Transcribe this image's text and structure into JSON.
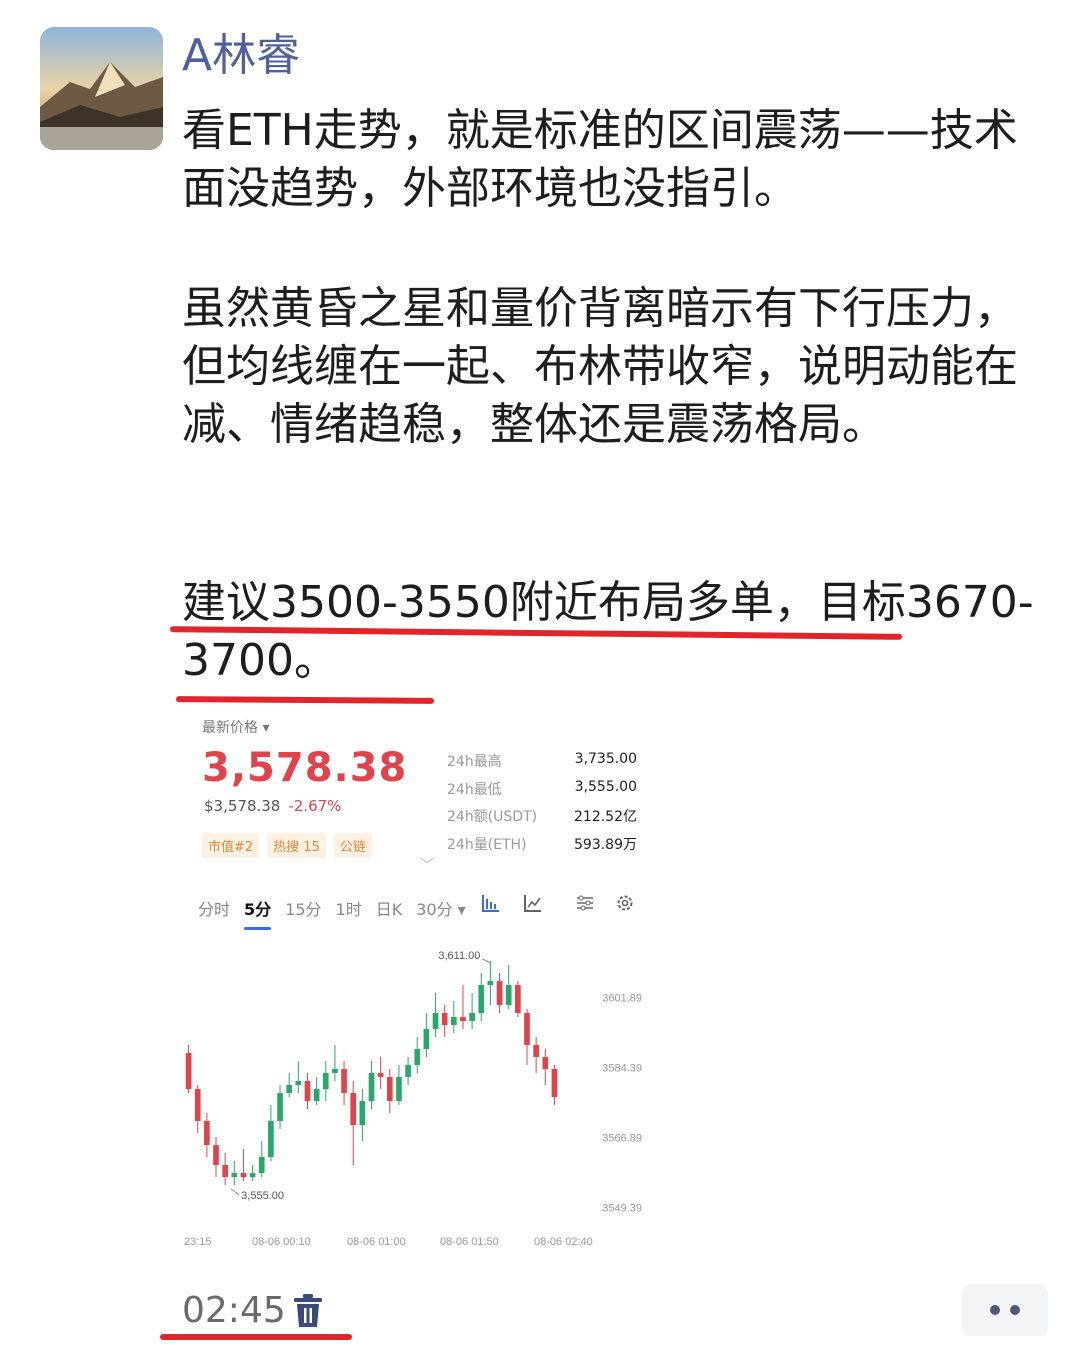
{
  "post": {
    "author": "A林睿",
    "paragraph1": "看ETH走势，就是标准的区间震荡——技术面没趋势，外部环境也没指引。",
    "paragraph2": "虽然黄昏之星和量价背离暗示有下行压力，但均线缠在一起、布林带收窄，说明动能在减、情绪趋稳，整体还是震荡格局。",
    "paragraph3": "建议3500-3550附近布局多单，目标3670-3700。",
    "time": "02:45"
  },
  "ticker": {
    "price_label": "最新价格",
    "price": "3,578.38",
    "price_usd": "$3,578.38",
    "change": "-2.67%",
    "tags": [
      "市值#2",
      "热搜 15",
      "公链"
    ],
    "stats": [
      {
        "label": "24h最高",
        "value": "3,735.00"
      },
      {
        "label": "24h最低",
        "value": "3,555.00"
      },
      {
        "label": "24h额(USDT)",
        "value": "212.52亿"
      },
      {
        "label": "24h量(ETH)",
        "value": "593.89万"
      }
    ],
    "timeframes": [
      "分时",
      "5分",
      "15分",
      "1时",
      "日K",
      "30分"
    ],
    "active_timeframe": "5分"
  },
  "chart_data": {
    "type": "candlestick",
    "title": "",
    "up_color": "#2aa86b",
    "down_color": "#e0434b",
    "y_ticks": [
      3601.89,
      3584.39,
      3566.89,
      3549.39
    ],
    "ylim": [
      3545,
      3615
    ],
    "x_ticks": [
      "23:15",
      "08-06 00:10",
      "08-06 01:00",
      "08-06 01:50",
      "08-06 02:40"
    ],
    "annotations": [
      {
        "label": "3,611.00",
        "value": 3611.0
      },
      {
        "label": "3,555.00",
        "value": 3555.0
      }
    ],
    "candles": [
      {
        "o": 3588,
        "c": 3579,
        "h": 3590,
        "l": 3578
      },
      {
        "o": 3579,
        "c": 3571,
        "h": 3580,
        "l": 3568
      },
      {
        "o": 3571,
        "c": 3565,
        "h": 3573,
        "l": 3562
      },
      {
        "o": 3565,
        "c": 3560,
        "h": 3567,
        "l": 3557
      },
      {
        "o": 3560,
        "c": 3557,
        "h": 3563,
        "l": 3555
      },
      {
        "o": 3557,
        "c": 3558,
        "h": 3561,
        "l": 3555
      },
      {
        "o": 3558,
        "c": 3557,
        "h": 3564,
        "l": 3556
      },
      {
        "o": 3557,
        "c": 3558,
        "h": 3560,
        "l": 3556
      },
      {
        "o": 3558,
        "c": 3562,
        "h": 3566,
        "l": 3557
      },
      {
        "o": 3562,
        "c": 3571,
        "h": 3575,
        "l": 3561
      },
      {
        "o": 3571,
        "c": 3578,
        "h": 3580,
        "l": 3569
      },
      {
        "o": 3578,
        "c": 3580,
        "h": 3583,
        "l": 3577
      },
      {
        "o": 3580,
        "c": 3581,
        "h": 3586,
        "l": 3578
      },
      {
        "o": 3581,
        "c": 3576,
        "h": 3583,
        "l": 3574
      },
      {
        "o": 3576,
        "c": 3579,
        "h": 3582,
        "l": 3575
      },
      {
        "o": 3579,
        "c": 3583,
        "h": 3586,
        "l": 3576
      },
      {
        "o": 3583,
        "c": 3584,
        "h": 3590,
        "l": 3581
      },
      {
        "o": 3584,
        "c": 3578,
        "h": 3586,
        "l": 3575
      },
      {
        "o": 3578,
        "c": 3570,
        "h": 3581,
        "l": 3560
      },
      {
        "o": 3570,
        "c": 3576,
        "h": 3579,
        "l": 3566
      },
      {
        "o": 3576,
        "c": 3583,
        "h": 3586,
        "l": 3574
      },
      {
        "o": 3583,
        "c": 3582,
        "h": 3587,
        "l": 3579
      },
      {
        "o": 3582,
        "c": 3576,
        "h": 3584,
        "l": 3573
      },
      {
        "o": 3576,
        "c": 3582,
        "h": 3585,
        "l": 3575
      },
      {
        "o": 3582,
        "c": 3585,
        "h": 3587,
        "l": 3580
      },
      {
        "o": 3585,
        "c": 3589,
        "h": 3592,
        "l": 3583
      },
      {
        "o": 3589,
        "c": 3594,
        "h": 3598,
        "l": 3587
      },
      {
        "o": 3594,
        "c": 3598,
        "h": 3603,
        "l": 3592
      },
      {
        "o": 3598,
        "c": 3595,
        "h": 3600,
        "l": 3592
      },
      {
        "o": 3595,
        "c": 3597,
        "h": 3601,
        "l": 3593
      },
      {
        "o": 3597,
        "c": 3596,
        "h": 3605,
        "l": 3594
      },
      {
        "o": 3596,
        "c": 3598,
        "h": 3603,
        "l": 3594
      },
      {
        "o": 3598,
        "c": 3605,
        "h": 3608,
        "l": 3596
      },
      {
        "o": 3605,
        "c": 3606,
        "h": 3611,
        "l": 3600
      },
      {
        "o": 3606,
        "c": 3600,
        "h": 3608,
        "l": 3598
      },
      {
        "o": 3600,
        "c": 3605,
        "h": 3610,
        "l": 3599
      },
      {
        "o": 3605,
        "c": 3598,
        "h": 3606,
        "l": 3597
      },
      {
        "o": 3598,
        "c": 3590,
        "h": 3599,
        "l": 3585
      },
      {
        "o": 3590,
        "c": 3587,
        "h": 3592,
        "l": 3583
      },
      {
        "o": 3587,
        "c": 3584,
        "h": 3589,
        "l": 3580
      },
      {
        "o": 3584,
        "c": 3577,
        "h": 3585,
        "l": 3575
      }
    ]
  }
}
